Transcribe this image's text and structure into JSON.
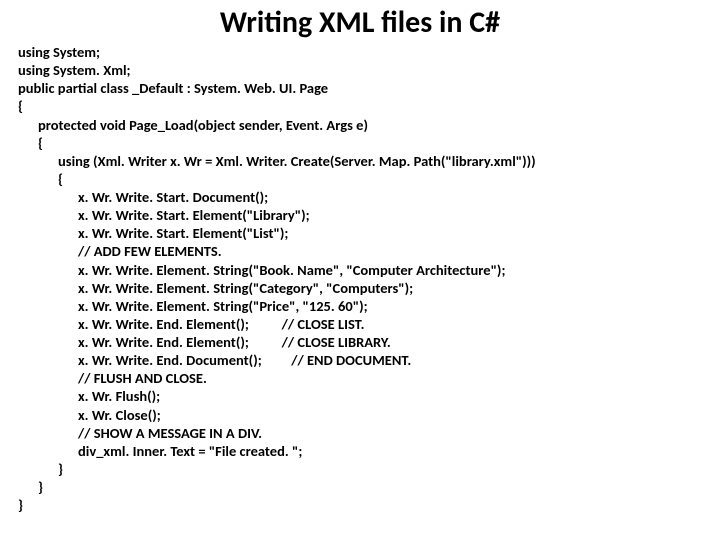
{
  "title": "Writing XML files in C#",
  "lines": [
    {
      "cls": "",
      "t": "using System;"
    },
    {
      "cls": "",
      "t": "using System. Xml;"
    },
    {
      "cls": "",
      "t": "public partial class _Default : System. Web. UI. Page"
    },
    {
      "cls": "",
      "t": "{"
    },
    {
      "cls": "ind1",
      "t": "protected void Page_Load(object sender, Event. Args e)"
    },
    {
      "cls": "ind1",
      "t": "{"
    },
    {
      "cls": "ind2",
      "t": "using (Xml. Writer x. Wr = Xml. Writer. Create(Server. Map. Path(\"library.xml\")))"
    },
    {
      "cls": "ind2",
      "t": "{"
    },
    {
      "cls": "ind3",
      "t": "x. Wr. Write. Start. Document();"
    },
    {
      "cls": "ind3",
      "t": "x. Wr. Write. Start. Element(\"Library\");"
    },
    {
      "cls": "ind3",
      "t": "x. Wr. Write. Start. Element(\"List\");"
    },
    {
      "cls": "ind3",
      "t": "// ADD FEW ELEMENTS."
    },
    {
      "cls": "ind3",
      "t": "x. Wr. Write. Element. String(\"Book. Name\", \"Computer Architecture\");"
    },
    {
      "cls": "ind3",
      "t": "x. Wr. Write. Element. String(\"Category\", \"Computers\");"
    },
    {
      "cls": "ind3",
      "t": "x. Wr. Write. Element. String(\"Price\", \"125. 60\");"
    },
    {
      "cls": "ind3",
      "t": "x. Wr. Write. End. Element();          // CLOSE LIST."
    },
    {
      "cls": "ind3",
      "t": "x. Wr. Write. End. Element();          // CLOSE LIBRARY."
    },
    {
      "cls": "ind3",
      "t": "x. Wr. Write. End. Document();         // END DOCUMENT."
    },
    {
      "cls": "ind3",
      "t": "// FLUSH AND CLOSE."
    },
    {
      "cls": "ind3",
      "t": "x. Wr. Flush();"
    },
    {
      "cls": "ind3",
      "t": "x. Wr. Close();"
    },
    {
      "cls": "ind3",
      "t": "// SHOW A MESSAGE IN A DIV."
    },
    {
      "cls": "ind3",
      "t": "div_xml. Inner. Text = \"File created. \";"
    },
    {
      "cls": "ind2",
      "t": "}"
    },
    {
      "cls": "ind1",
      "t": "}"
    },
    {
      "cls": "",
      "t": "}"
    }
  ]
}
